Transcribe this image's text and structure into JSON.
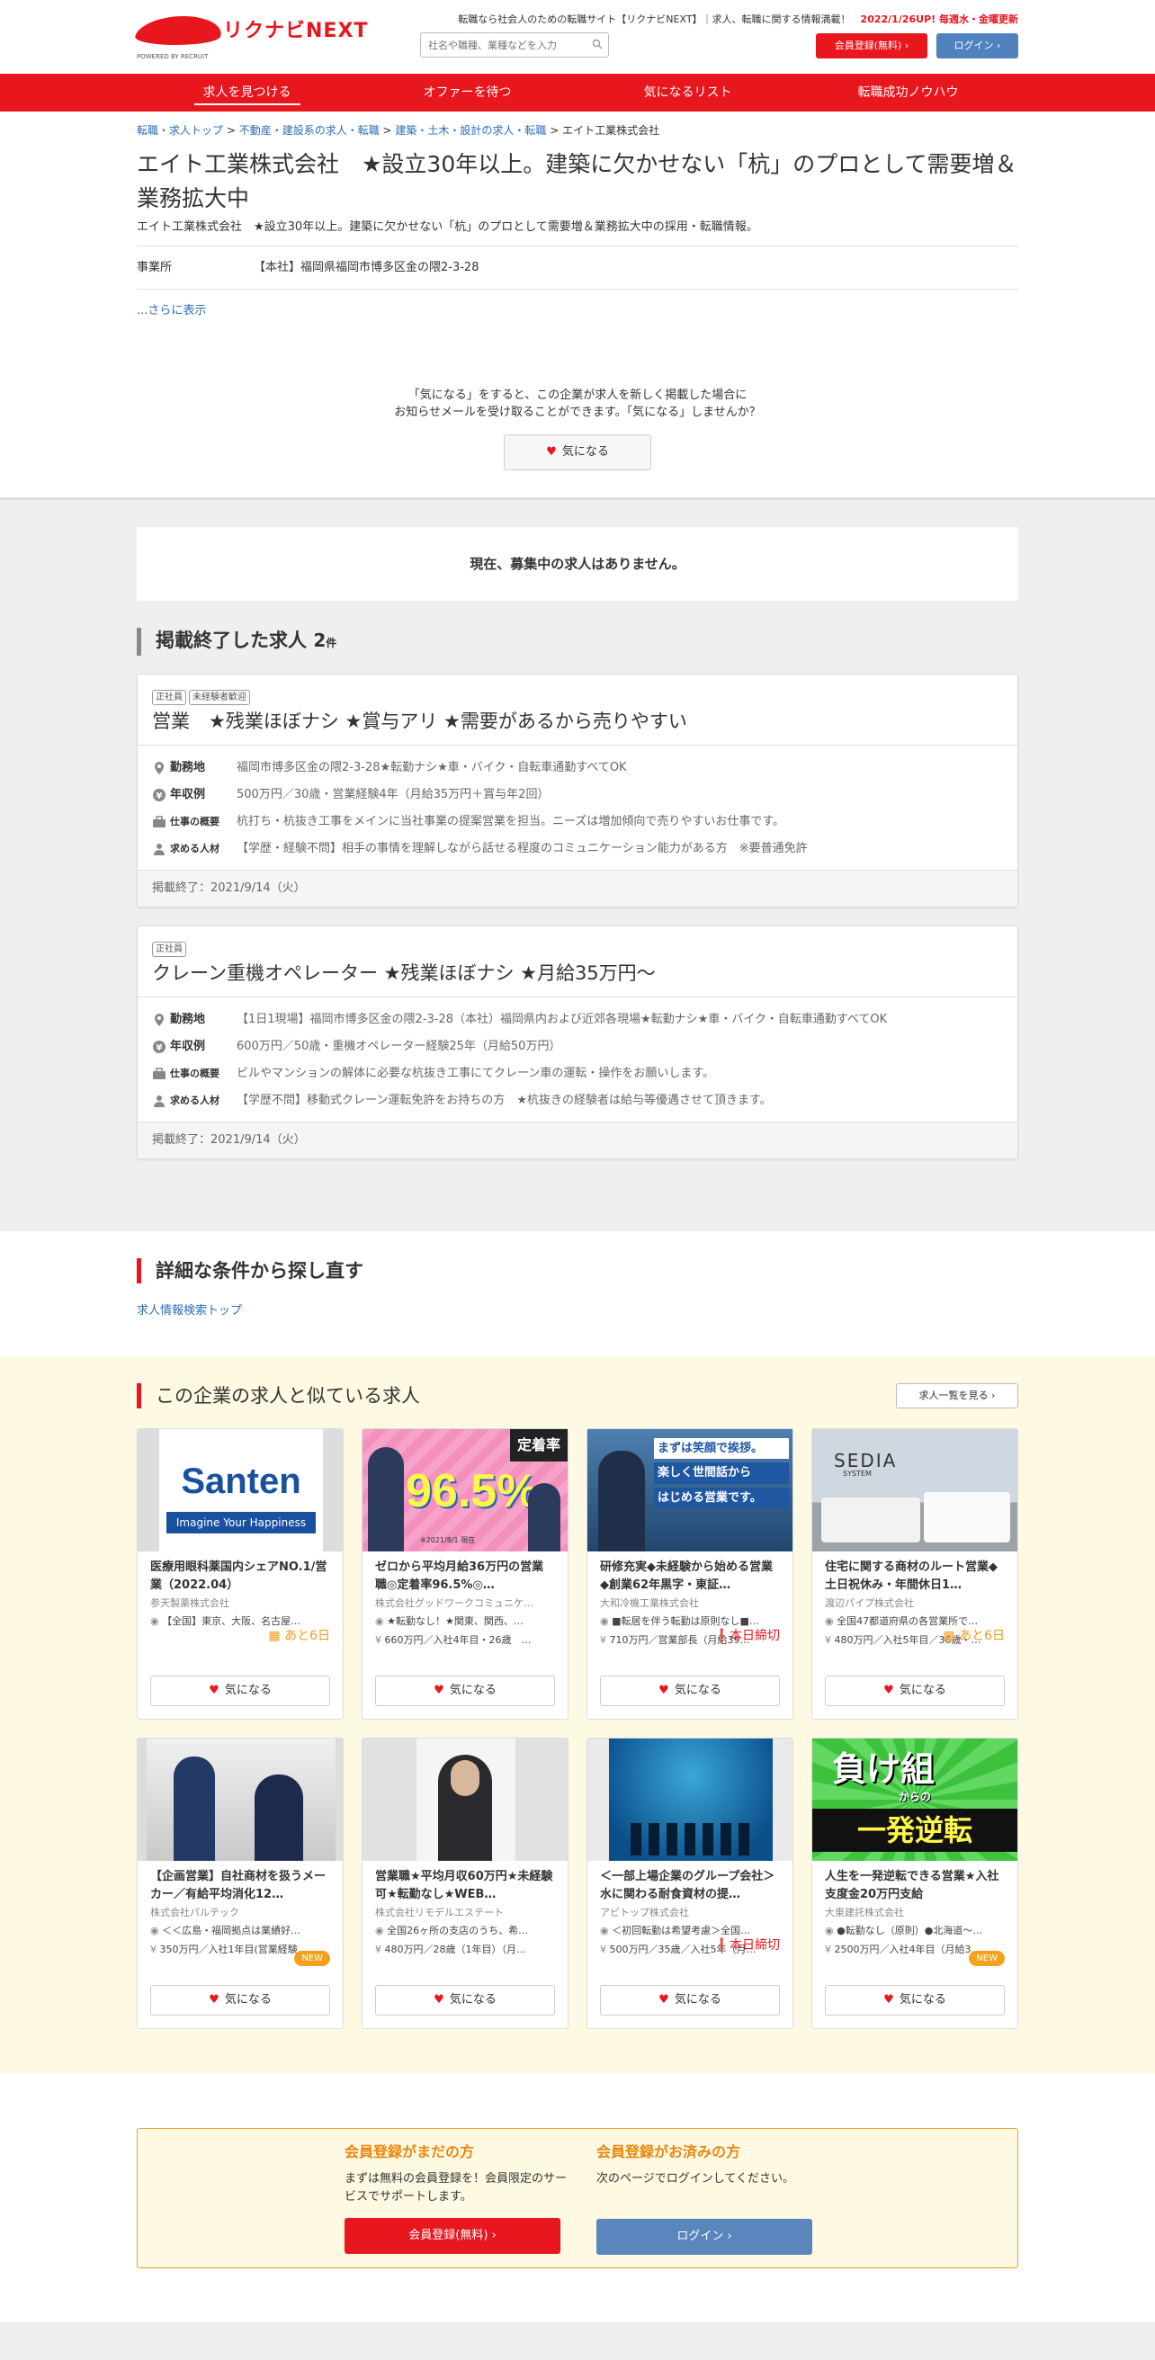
{
  "header": {
    "logo_text": "リクナビNEXT",
    "powered_by": "POWERED BY RECRUIT",
    "tagline": "転職なら社会人のための転職サイト【リクナビNEXT】｜求人、転職に関する情報満載！",
    "update": "2022/1/26UP! 毎週水・金曜更新",
    "search_placeholder": "社名や職種、業種などを入力",
    "register_label": "会員登録(無料)",
    "login_label": "ログイン"
  },
  "nav": [
    "求人を見つける",
    "オファーを待つ",
    "気になるリスト",
    "転職成功ノウハウ"
  ],
  "breadcrumb": [
    "転職・求人トップ",
    "不動産・建設系の求人・転職",
    "建築・土木・設計の求人・転職",
    "エイト工業株式会社"
  ],
  "company": {
    "title": "エイト工業株式会社　★設立30年以上。建築に欠かせない「杭」のプロとして需要増＆業務拡大中",
    "subtitle": "エイト工業株式会社　★設立30年以上。建築に欠かせない「杭」のプロとして需要増＆業務拡大中の採用・転職情報。",
    "office_label": "事業所",
    "office_value": "【本社】福岡県福岡市博多区金の隈2-3-28",
    "more_label": "...さらに表示"
  },
  "kininaru": {
    "line1": "「気になる」をすると、この企業が求人を新しく掲載した場合に",
    "line2": "お知らせメールを受け取ることができます。「気になる」しませんか？",
    "button": "気になる"
  },
  "no_jobs": "現在、募集中の求人はありません。",
  "ended": {
    "heading": "掲載終了した求人",
    "count": "2",
    "count_unit": "件",
    "jobs": [
      {
        "tags": [
          "正社員",
          "未経験者歓迎"
        ],
        "title": "営業　★残業ほぼナシ ★賞与アリ ★需要があるから売りやすい",
        "location_label": "勤務地",
        "location": "福岡市博多区金の隈2-3-28★転勤ナシ★車・バイク・自転車通勤すべてOK",
        "salary_label": "年収例",
        "salary": "500万円／30歳・営業経験4年（月給35万円＋賞与年2回）",
        "summary_label": "仕事の概要",
        "summary": "杭打ち・杭抜き工事をメインに当社事業の提案営業を担当。ニーズは増加傾向で売りやすいお仕事です。",
        "req_label": "求める人材",
        "req": "【学歴・経験不問】相手の事情を理解しながら話せる程度のコミュニケーション能力がある方　※要普通免許",
        "end": "掲載終了：2021/9/14（火）"
      },
      {
        "tags": [
          "正社員"
        ],
        "title": "クレーン重機オペレーター ★残業ほぼナシ ★月給35万円～",
        "location_label": "勤務地",
        "location": "【1日1現場】福岡市博多区金の隈2-3-28（本社）福岡県内および近郊各現場★転勤ナシ★車・バイク・自転車通勤すべてOK",
        "salary_label": "年収例",
        "salary": "600万円／50歳・重機オペレーター経験25年（月給50万円）",
        "summary_label": "仕事の概要",
        "summary": "ビルやマンションの解体に必要な杭抜き工事にてクレーン車の運転・操作をお願いします。",
        "req_label": "求める人材",
        "req": "【学歴不問】移動式クレーン運転免許をお持ちの方　★杭抜きの経験者は給与等優遇させて頂きます。",
        "end": "掲載終了：2021/9/14（火）"
      }
    ]
  },
  "detail": {
    "heading": "詳細な条件から探し直す",
    "link": "求人情報検索トップ"
  },
  "similar": {
    "heading": "この企業の求人と似ている求人",
    "all_label": "求人一覧を見る",
    "button": "気になる",
    "items": [
      {
        "img": "santen",
        "img_text1": "Santen",
        "img_text2": "Imagine Your Happiness",
        "title": "医療用眼科薬国内シェアNO.1/営業（2022.04）",
        "company": "参天製薬株式会社",
        "loc": "【全国】東京、大阪、名古屋…",
        "sal": "",
        "badge": "あと6日",
        "badge_type": "ato"
      },
      {
        "img": "rate",
        "img_text1": "定着率",
        "img_text2": "96.5%",
        "img_text3": "※2021/8/1 現在",
        "title": "ゼロから平均月給36万円の営業職◎定着率96.5%◎…",
        "company": "株式会社グッドワークコミュニケ…",
        "loc": "★転勤なし！★関東、関西、…",
        "sal": "660万円／入社4年目・26歳　…",
        "badge": "",
        "badge_type": ""
      },
      {
        "img": "smile",
        "img_text1": "まずは笑顔で挨拶。",
        "img_text2": "楽しく世間話から",
        "img_text3": "はじめる営業です。",
        "title": "研修充実◆未経験から始める営業◆創業62年黒字・東証…",
        "company": "大和冷機工業株式会社",
        "loc": "■転居を伴う転勤は原則なし■…",
        "sal": "710万円／営業部長（月給39…",
        "badge": "本日締切",
        "badge_type": "today"
      },
      {
        "img": "sedia",
        "img_text1": "SEDIA",
        "img_text2": "SYSTEM",
        "title": "住宅に関する商材のルート営業◆土日祝休み・年間休日1…",
        "company": "渡辺パイプ株式会社",
        "loc": "全国47都道府県の各営業所で…",
        "sal": "480万円／入社5年目／36歳・…",
        "badge": "あと6日",
        "badge_type": "ato"
      },
      {
        "img": "office",
        "title": "【企画営業】自社商材を扱うメーカー／有給平均消化12…",
        "company": "株式会社パルテック",
        "loc": "＜＜広島・福岡拠点は業績好…",
        "sal": "350万円／入社1年目(営業経験…",
        "badge": "NEW",
        "badge_type": "new"
      },
      {
        "img": "man",
        "title": "営業職★平均月収60万円★未経験可★転勤なし★WEB…",
        "company": "株式会社リモデルエステート",
        "loc": "全国26ヶ所の支店のうち、希…",
        "sal": "480万円／28歳（1年目）（月…",
        "badge": "",
        "badge_type": ""
      },
      {
        "img": "aquarium",
        "title": "＜一部上場企業のグループ会社＞水に関わる耐食資材の提…",
        "company": "アビトップ株式会社",
        "loc": "＜初回転勤は希望考慮＞全国…",
        "sal": "500万円／35歳／入社5年（月…",
        "badge": "本日締切",
        "badge_type": "today"
      },
      {
        "img": "makegumi",
        "img_text1": "負け組",
        "img_text2": "からの",
        "img_text3": "一発逆転",
        "title": "人生を一発逆転できる営業★入社支度金20万円支給",
        "company": "大東建託株式会社",
        "loc": "●転勤なし（原則）●北海道～…",
        "sal": "2500万円／入社4年目（月給3…",
        "badge": "NEW",
        "badge_type": "new"
      }
    ]
  },
  "member": {
    "not_yet_title": "会員登録がまだの方",
    "not_yet_text": "まずは無料の会員登録を！会員限定のサービスでサポートします。",
    "not_yet_button": "会員登録(無料)",
    "done_title": "会員登録がお済みの方",
    "done_text": "次のページでログインしてください。",
    "done_button": "ログイン"
  },
  "colors": {
    "brand": "#e8161d",
    "link": "#2a6db8",
    "login": "#4f82bf",
    "accent": "#f09a1c"
  }
}
